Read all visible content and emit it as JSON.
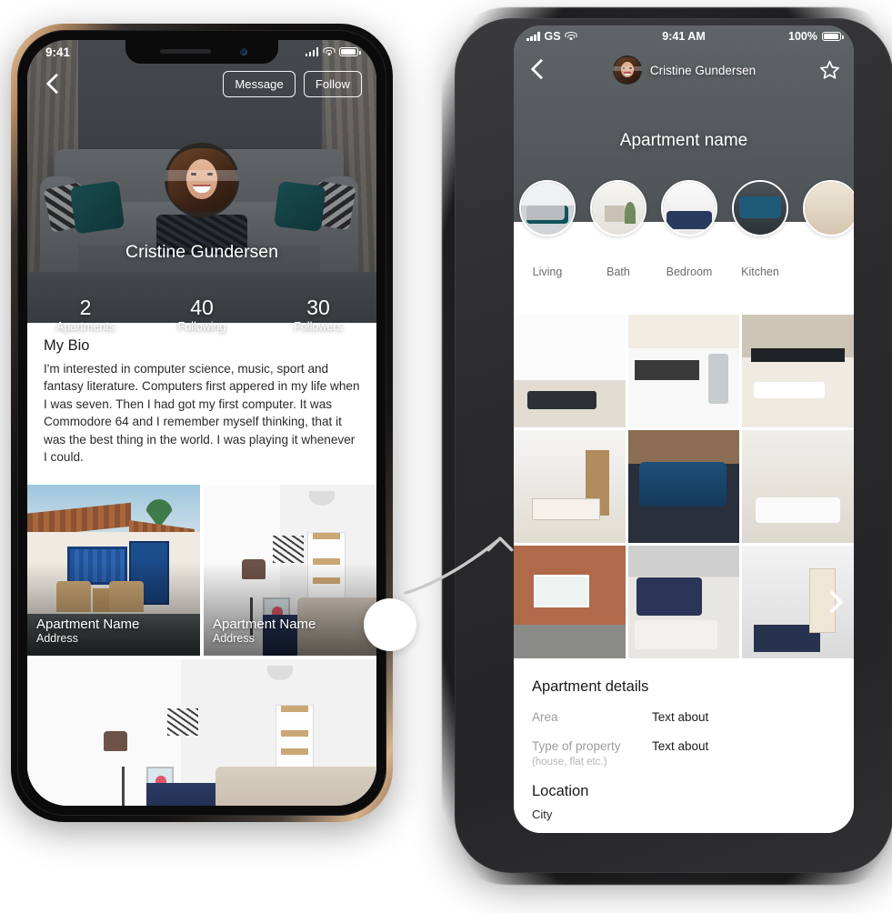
{
  "left_phone": {
    "status_bar": {
      "time": "9:41",
      "signal_icon": "signal-bars-icon",
      "wifi_icon": "wifi-icon",
      "battery_icon": "battery-icon"
    },
    "nav": {
      "back_icon": "chevron-left-icon",
      "message_label": "Message",
      "follow_label": "Follow"
    },
    "profile": {
      "avatar": "user-avatar",
      "name": "Cristine Gundersen",
      "stats": [
        {
          "value": "2",
          "label": "Apartments"
        },
        {
          "value": "40",
          "label": "Following"
        },
        {
          "value": "30",
          "label": "Followers"
        }
      ]
    },
    "bio": {
      "title": "My Bio",
      "text": "I'm interested in computer science, music, sport and fantasy literature. Computers first appered in my life when I was seven. Then I had got my first computer. It was Commodore 64 and I remember myself thinking, that it was the best thing in the world. I was playing it whenever I could."
    },
    "apartment_cards": [
      {
        "title": "Apartment Name",
        "subtitle": "Address",
        "image": "villa-courtyard-photo"
      },
      {
        "title": "Apartment Name",
        "subtitle": "Address",
        "image": "white-bedroom-photo"
      }
    ],
    "wide_card": {
      "image": "white-interior-wide-photo"
    }
  },
  "right_phone": {
    "status_bar": {
      "carrier": "GS",
      "time": "9:41 AM",
      "battery_percent": "100%",
      "signal_icon": "signal-bars-icon",
      "wifi_icon": "wifi-icon",
      "battery_icon": "battery-icon"
    },
    "nav": {
      "back_icon": "chevron-left-icon",
      "avatar": "user-avatar",
      "user_name": "Cristine Gundersen",
      "favorite_icon": "star-outline-icon"
    },
    "hero": {
      "title": "Apartment name",
      "image": "living-room-hero-photo"
    },
    "categories": [
      {
        "label": "Living",
        "thumb": "living-room-thumb"
      },
      {
        "label": "Bath",
        "thumb": "bathroom-thumb"
      },
      {
        "label": "Bedroom",
        "thumb": "bedroom-thumb"
      },
      {
        "label": "Kitchen",
        "thumb": "kitchen-thumb"
      },
      {
        "label": "",
        "thumb": "extra-room-thumb"
      }
    ],
    "gallery": {
      "next_icon": "chevron-right-icon",
      "photos": [
        "white-living-room",
        "kitchen-dining",
        "bathroom-double-sink",
        "dining-bookshelf",
        "blue-sectional-loft",
        "modern-white-living",
        "brick-wall-lounge",
        "navy-bedroom",
        "white-bedroom-door"
      ]
    },
    "details": {
      "title": "Apartment details",
      "rows": [
        {
          "label": "Area",
          "sublabel": "",
          "value": "Text about"
        },
        {
          "label": "Type of property",
          "sublabel": "(house, flat etc.)",
          "value": "Text about"
        }
      ],
      "location_title": "Location",
      "city": "City"
    }
  },
  "annotation": {
    "tap_indicator": "tap-circle",
    "flow_arrow_icon": "curved-arrow-icon"
  }
}
